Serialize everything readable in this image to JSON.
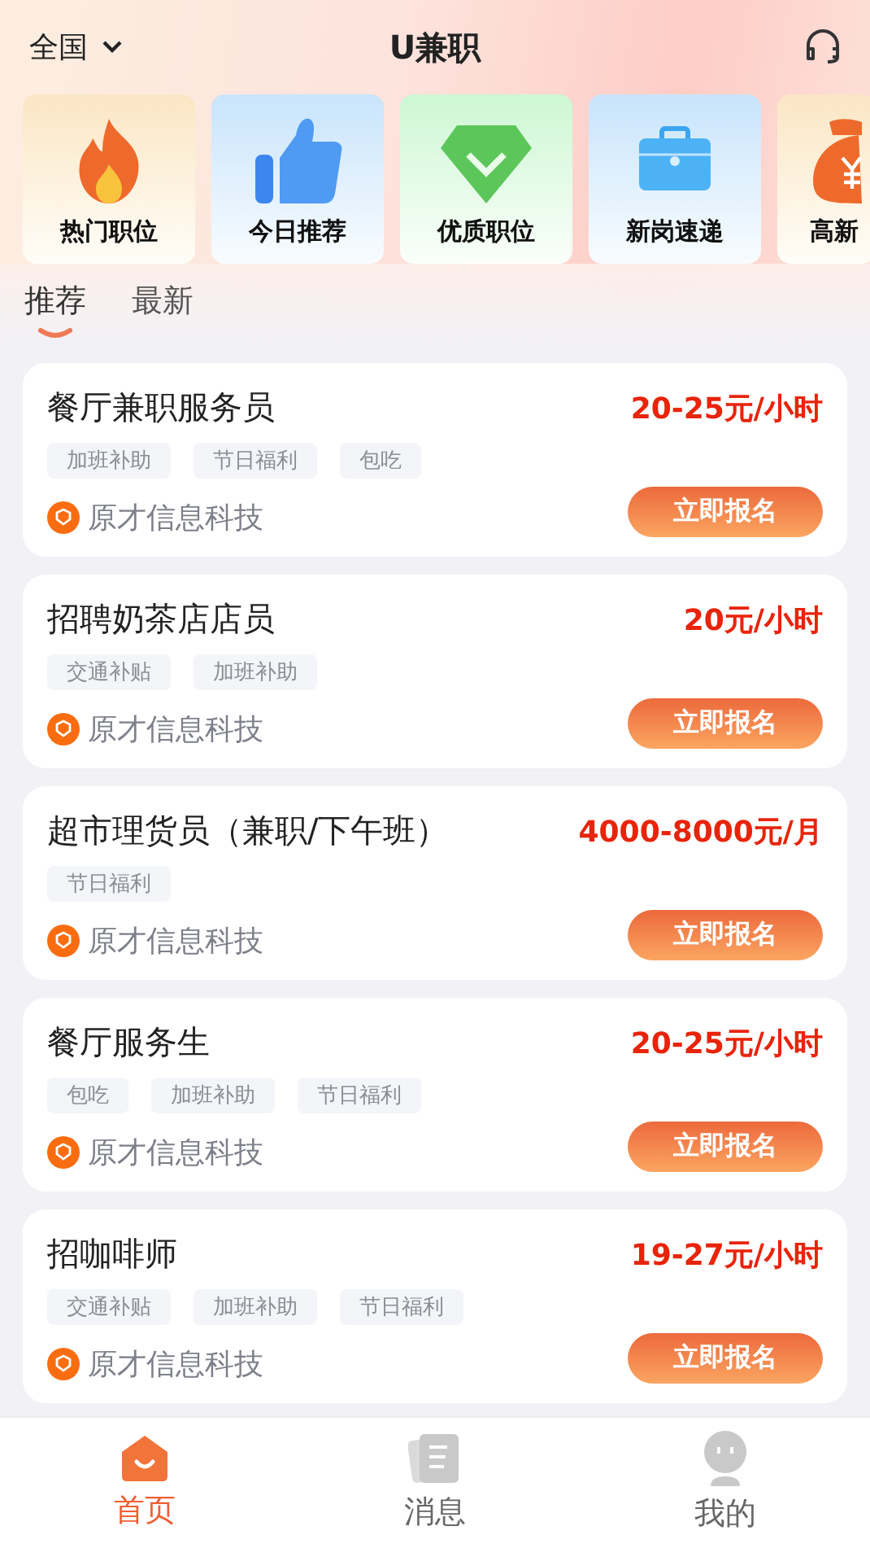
{
  "header": {
    "location": "全国",
    "title": "U兼职"
  },
  "categories": [
    {
      "label": "热门职位",
      "kind": "fire"
    },
    {
      "label": "今日推荐",
      "kind": "thumb"
    },
    {
      "label": "优质职位",
      "kind": "gem"
    },
    {
      "label": "新岗速递",
      "kind": "case"
    },
    {
      "label": "高新",
      "kind": "money"
    }
  ],
  "tabs": [
    {
      "label": "推荐",
      "selected": true
    },
    {
      "label": "最新",
      "selected": false
    }
  ],
  "jobs": [
    {
      "title": "餐厅兼职服务员",
      "salary": "20-25元/小时",
      "tags": [
        "加班补助",
        "节日福利",
        "包吃"
      ],
      "company": "原才信息科技",
      "button": "立即报名"
    },
    {
      "title": "招聘奶茶店店员",
      "salary": "20元/小时",
      "tags": [
        "交通补贴",
        "加班补助"
      ],
      "company": "原才信息科技",
      "button": "立即报名"
    },
    {
      "title": "超市理货员（兼职/下午班）",
      "salary": "4000-8000元/月",
      "tags": [
        "节日福利"
      ],
      "company": "原才信息科技",
      "button": "立即报名"
    },
    {
      "title": "餐厅服务生",
      "salary": "20-25元/小时",
      "tags": [
        "包吃",
        "加班补助",
        "节日福利"
      ],
      "company": "原才信息科技",
      "button": "立即报名"
    },
    {
      "title": "招咖啡师",
      "salary": "19-27元/小时",
      "tags": [
        "交通补贴",
        "加班补助",
        "节日福利"
      ],
      "company": "原才信息科技",
      "button": "立即报名"
    }
  ],
  "nav": [
    {
      "label": "首页",
      "kind": "home",
      "selected": true
    },
    {
      "label": "消息",
      "kind": "msg",
      "selected": false
    },
    {
      "label": "我的",
      "kind": "me",
      "selected": false
    }
  ]
}
